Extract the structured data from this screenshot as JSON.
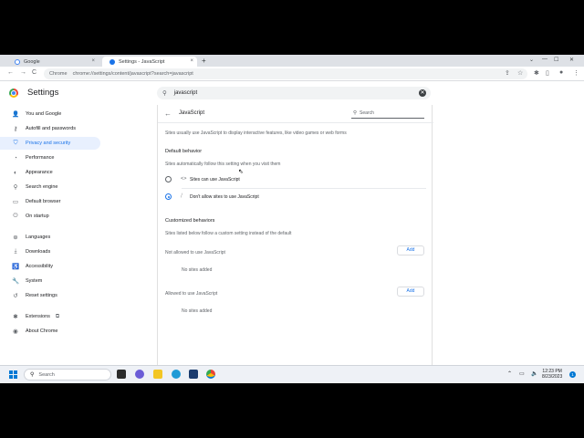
{
  "tabs": [
    {
      "title": "Google",
      "close": "×"
    },
    {
      "title": "Settings - JavaScript",
      "close": "×"
    }
  ],
  "new_tab_label": "+",
  "window_controls": [
    "⌄",
    "—",
    "☐",
    "✕"
  ],
  "toolbar": {
    "back": "←",
    "forward": "→",
    "reload": "C",
    "site_chip": "Chrome",
    "url": "chrome://settings/content/javascript?search=javascript"
  },
  "settings": {
    "title": "Settings",
    "search_value": "javascript",
    "search_clear": "✕"
  },
  "sidebar": {
    "items": [
      {
        "label": "You and Google",
        "icon": "person-icon"
      },
      {
        "label": "Autofill and passwords",
        "icon": "key-icon"
      },
      {
        "label": "Privacy and security",
        "icon": "shield-icon"
      },
      {
        "label": "Performance",
        "icon": "speedometer-icon"
      },
      {
        "label": "Appearance",
        "icon": "palette-icon"
      },
      {
        "label": "Search engine",
        "icon": "search-icon"
      },
      {
        "label": "Default browser",
        "icon": "browser-icon"
      },
      {
        "label": "On startup",
        "icon": "power-icon"
      },
      {
        "label": "Languages",
        "icon": "globe-icon"
      },
      {
        "label": "Downloads",
        "icon": "download-icon"
      },
      {
        "label": "Accessibility",
        "icon": "accessibility-icon"
      },
      {
        "label": "System",
        "icon": "wrench-icon"
      },
      {
        "label": "Reset settings",
        "icon": "reset-icon"
      },
      {
        "label": "Extensions",
        "icon": "puzzle-icon"
      },
      {
        "label": "About Chrome",
        "icon": "chrome-icon"
      }
    ]
  },
  "main": {
    "title": "JavaScript",
    "search_placeholder": "Search",
    "intro": "Sites usually use JavaScript to display interactive features, like video games or web forms",
    "default_behavior": {
      "heading": "Default behavior",
      "subtext": "Sites automatically follow this setting when you visit them",
      "options": [
        {
          "label": "Sites can use JavaScript",
          "icon": "code-icon",
          "selected": false
        },
        {
          "label": "Don't allow sites to use JavaScript",
          "icon": "code-off-icon",
          "selected": true
        }
      ]
    },
    "customized": {
      "heading": "Customized behaviors",
      "subtext": "Sites listed below follow a custom setting instead of the default",
      "not_allowed": {
        "label": "Not allowed to use JavaScript",
        "button": "Add",
        "empty": "No sites added"
      },
      "allowed": {
        "label": "Allowed to use JavaScript",
        "button": "Add",
        "empty": "No sites added"
      }
    }
  },
  "taskbar": {
    "search_placeholder": "Search",
    "time": "12:23 PM",
    "date": "8/23/2023",
    "notifications": "1"
  },
  "colors": {
    "accent": "#1a73e8",
    "active_bg": "#e8f0fe",
    "taskbar_bg": "#eef1f6"
  }
}
